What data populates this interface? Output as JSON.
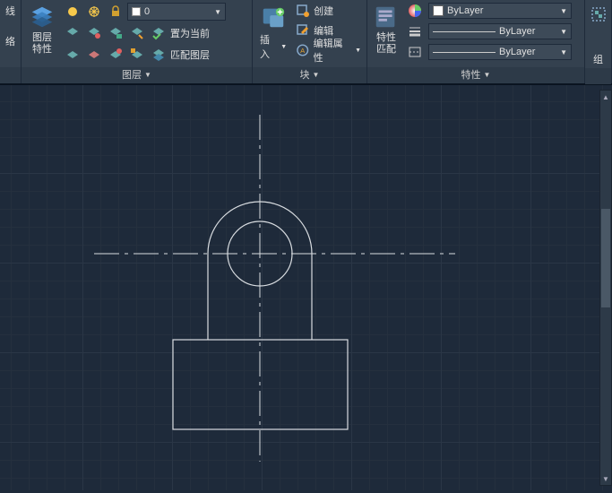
{
  "panels": {
    "lines": {
      "title": "线",
      "sub": "络"
    },
    "layers": {
      "title": "图层",
      "big_btn": "图层\n特性",
      "current_layer": "0",
      "make_current": "置为当前",
      "match_layer": "匹配图层"
    },
    "block": {
      "title": "块",
      "big_btn": "插入",
      "create": "创建",
      "edit": "编辑",
      "edit_attributes": "编辑属性"
    },
    "properties": {
      "title": "特性",
      "big_btn": "特性",
      "match": "匹配",
      "color": "ByLayer",
      "lineweight": "ByLayer",
      "linetype": "ByLayer"
    },
    "group": {
      "title": "组"
    }
  },
  "icons": {
    "layers_big": "layers-stack-icon",
    "insert_big": "insert-block-icon",
    "properties_big": "properties-palette-icon"
  }
}
